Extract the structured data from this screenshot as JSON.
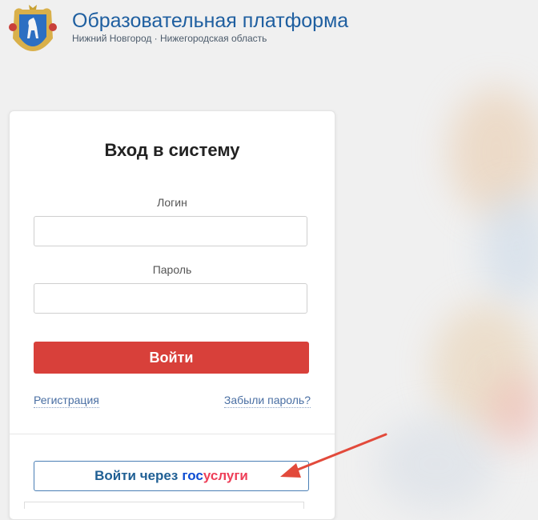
{
  "header": {
    "title": "Образовательная платформа",
    "subtitle": "Нижний Новгород · Нижегородская область",
    "crest_icon": "nizhny-novgorod-coat-of-arms"
  },
  "login": {
    "title": "Вход в систему",
    "login_label": "Логин",
    "login_value": "",
    "password_label": "Пароль",
    "password_value": "",
    "submit_label": "Войти",
    "register_link": "Регистрация",
    "forgot_link": "Забыли пароль?",
    "gosuslugi_prefix": "Войти через",
    "gosuslugi_logo_a": "гос",
    "gosuslugi_logo_b": "услуги"
  },
  "colors": {
    "accent_blue": "#1f5fa0",
    "login_button": "#d8403a",
    "gos_blue": "#0d4cd3",
    "gos_red": "#ee3f58",
    "arrow": "#e24a3b"
  }
}
